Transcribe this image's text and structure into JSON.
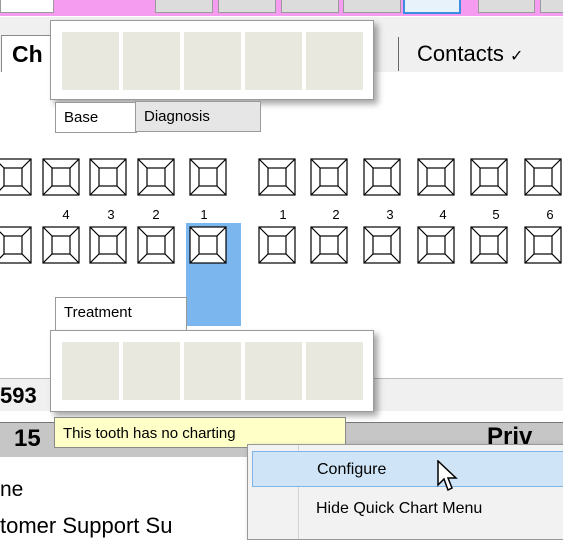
{
  "toolbar": {
    "buttons": 8
  },
  "tabs": {
    "chart_label": "Ch",
    "contacts_label": "Contacts",
    "contacts_suffix": "✓"
  },
  "quick_chart": {
    "base_tab": "Base",
    "diagnosis_tab": "Diagnosis",
    "treatment_tab": "Treatment",
    "swatch_color": "#e8e8df"
  },
  "tooth_chart": {
    "upper_numbers_left": [
      "4",
      "3",
      "2",
      "1"
    ],
    "upper_numbers_right": [
      "1",
      "2",
      "3",
      "4",
      "5",
      "6"
    ],
    "selected_color": "#7bb6ee"
  },
  "info": {
    "id_fragment": "593",
    "row_num": "15",
    "row_right": "Priv",
    "row_ne": "ne",
    "row_support": "tomer Support Su"
  },
  "tooltip": {
    "text": "This tooth has no charting"
  },
  "context_menu": {
    "items": [
      "Configure",
      "Hide Quick Chart Menu"
    ]
  }
}
